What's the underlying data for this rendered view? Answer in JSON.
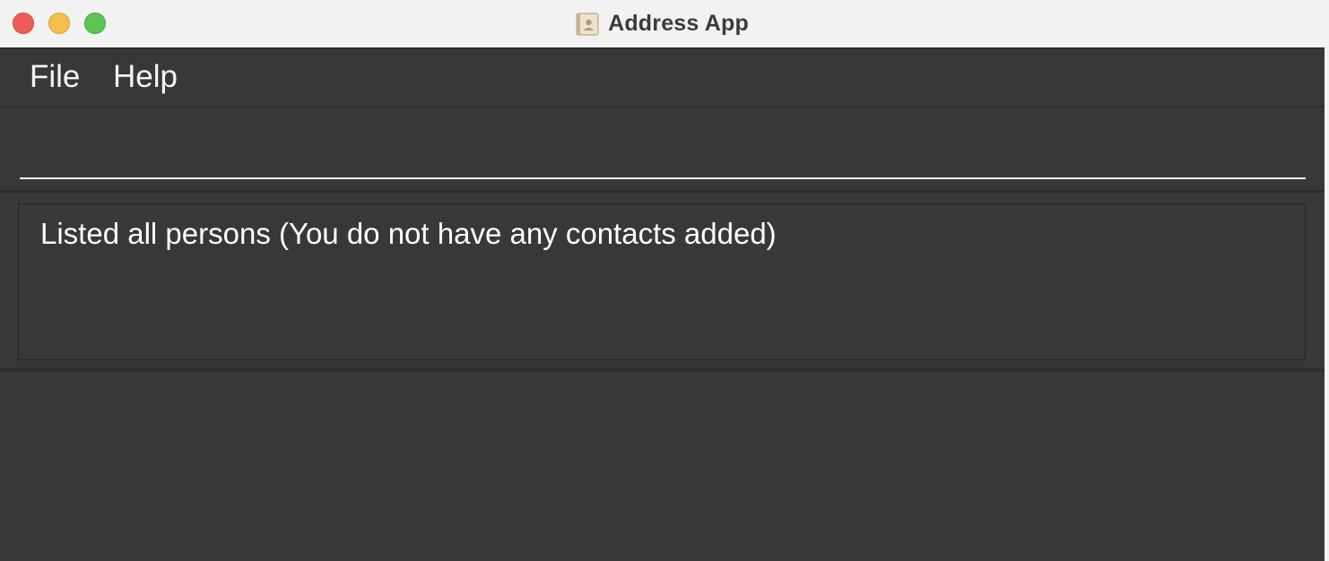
{
  "window": {
    "title": "Address App",
    "app_icon": "address-book-icon",
    "controls": [
      "close",
      "minimize",
      "zoom"
    ]
  },
  "menu": {
    "items": [
      {
        "label": "File"
      },
      {
        "label": "Help"
      }
    ]
  },
  "command_box": {
    "value": "",
    "placeholder": ""
  },
  "result_display": {
    "text": "Listed all persons (You do not have any contacts added)"
  },
  "colors": {
    "background": "#383838",
    "titlebar": "#f2f2f2",
    "text": "#ffffff",
    "close": "#ee5e58",
    "minimize": "#f6be4f",
    "zoom": "#5fc454"
  }
}
